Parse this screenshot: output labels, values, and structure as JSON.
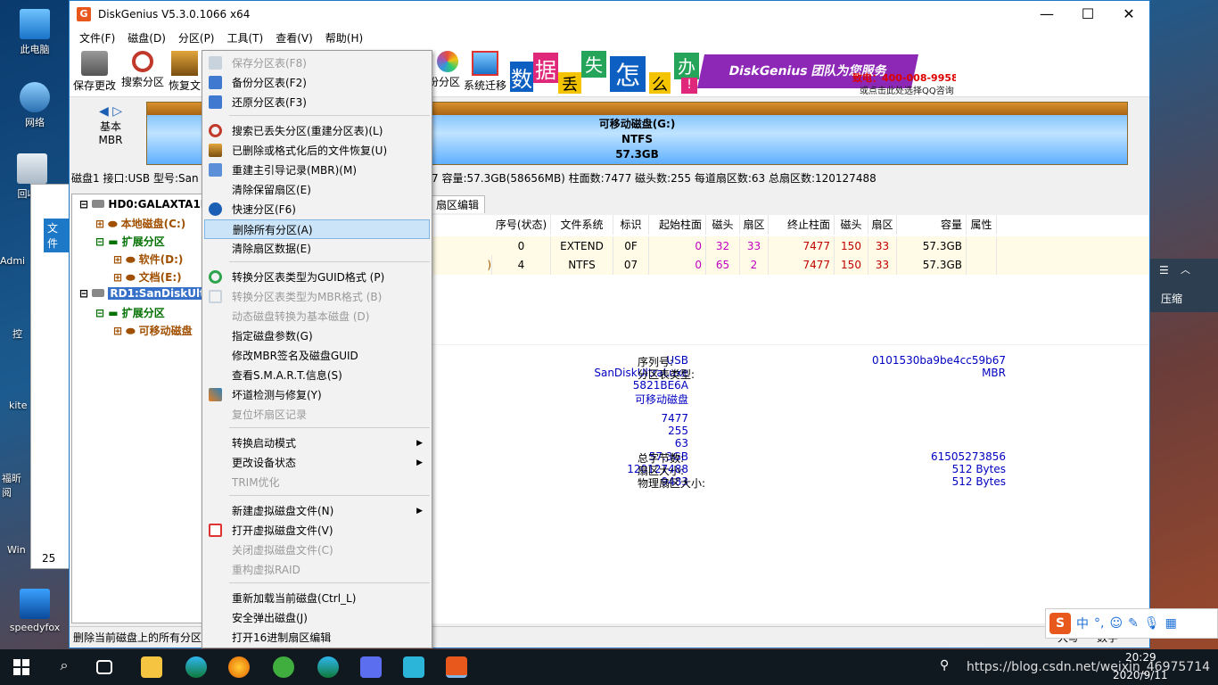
{
  "desktop": {
    "icons": [
      "此电脑",
      "网络",
      "回收站",
      "Admi",
      "控",
      "kite",
      "福昕阅",
      "Win",
      "speedyfox"
    ],
    "right_panel_label": "压缩",
    "explorer_tab": "文件",
    "explorer_count": "25"
  },
  "window": {
    "title": "DiskGenius V5.3.0.1066 x64",
    "app_icon_letter": "G",
    "min": "—",
    "max": "☐",
    "close": "✕"
  },
  "menubar": [
    "文件(F)",
    "磁盘(D)",
    "分区(P)",
    "工具(T)",
    "查看(V)",
    "帮助(H)"
  ],
  "toolbar": {
    "buttons": [
      "保存更改",
      "搜索分区",
      "恢复文",
      "份分区",
      "系统迁移"
    ]
  },
  "banner": {
    "chars": [
      "数",
      "据",
      "丢",
      "失",
      "怎",
      "么",
      "办",
      "!"
    ],
    "team": "DiskGenius 团队为您服务",
    "phone": "致电：400-008-9958",
    "qq": "或点击此处选择QQ咨询"
  },
  "disk_nav": {
    "line1": "基本",
    "line2": "MBR"
  },
  "disk_bar": {
    "name": "可移动磁盘(G:)",
    "fs": "NTFS",
    "size": "57.3GB"
  },
  "disk_info_prefix": "磁盘1 接口:USB  型号:San",
  "disk_info_suffix": "7  容量:57.3GB(58656MB)  柱面数:7477  磁头数:255  每道扇区数:63  总扇区数:120127488",
  "tree": [
    {
      "label": "HD0:GALAXTA1D",
      "level": 0
    },
    {
      "label": "本地磁盘(C:)",
      "level": 1
    },
    {
      "label": "扩展分区",
      "level": 1
    },
    {
      "label": "软件(D:)",
      "level": 2
    },
    {
      "label": "文档(E:)",
      "level": 2
    },
    {
      "label": "RD1:SanDiskUltr",
      "level": 0
    },
    {
      "label": "扩展分区",
      "level": 1
    },
    {
      "label": "可移动磁盘",
      "level": 2
    }
  ],
  "tab_visible": "扇区编辑",
  "table": {
    "headers": [
      "序号(状态)",
      "文件系统",
      "标识",
      "起始柱面",
      "磁头",
      "扇区",
      "终止柱面",
      "磁头",
      "扇区",
      "容量",
      "属性"
    ],
    "rows": [
      [
        "0",
        "EXTEND",
        "0F",
        "0",
        "32",
        "33",
        "7477",
        "150",
        "33",
        "57.3GB",
        ""
      ],
      [
        "4",
        "NTFS",
        "07",
        "0",
        "65",
        "2",
        "7477",
        "150",
        "33",
        "57.3GB",
        ""
      ]
    ],
    "row2_prefix": ")"
  },
  "details": {
    "left_values": [
      "USB",
      "SanDiskUltraLuxe",
      "5821BE6A",
      "可移动磁盘",
      "7477",
      "255",
      "63",
      "57.3GB",
      "120127488",
      "9483"
    ],
    "serial_label": "序列号:",
    "serial_value": "0101530ba9be4cc59b67",
    "ptype_label": "分区表类型:",
    "ptype_value": "MBR",
    "bytes_label": "总字节数:",
    "bytes_value": "61505273856",
    "sector_label": "扇区大小:",
    "sector_value": "512 Bytes",
    "phys_label": "物理扇区大小:",
    "phys_value": "512 Bytes"
  },
  "statusbar": {
    "text": "删除当前磁盘上的所有分区。",
    "right1": "大写",
    "right2": "数字"
  },
  "context_menu": [
    {
      "label": "保存分区表(F8)",
      "disabled": true
    },
    {
      "label": "备份分区表(F2)",
      "disabled": false
    },
    {
      "label": "还原分区表(F3)",
      "disabled": false
    },
    {
      "label": "搜索已丢失分区(重建分区表)(L)",
      "disabled": false
    },
    {
      "label": "已删除或格式化后的文件恢复(U)",
      "disabled": false
    },
    {
      "label": "重建主引导记录(MBR)(M)",
      "disabled": false
    },
    {
      "label": "清除保留扇区(E)",
      "disabled": false
    },
    {
      "label": "快速分区(F6)",
      "disabled": false
    },
    {
      "label": "删除所有分区(A)",
      "disabled": false,
      "highlight": true
    },
    {
      "label": "清除扇区数据(E)",
      "disabled": false
    },
    {
      "label": "转换分区表类型为GUID格式 (P)",
      "disabled": false
    },
    {
      "label": "转换分区表类型为MBR格式 (B)",
      "disabled": true
    },
    {
      "label": "动态磁盘转换为基本磁盘 (D)",
      "disabled": true
    },
    {
      "label": "指定磁盘参数(G)",
      "disabled": false
    },
    {
      "label": "修改MBR签名及磁盘GUID",
      "disabled": false
    },
    {
      "label": "查看S.M.A.R.T.信息(S)",
      "disabled": false
    },
    {
      "label": "坏道检测与修复(Y)",
      "disabled": false
    },
    {
      "label": "复位坏扇区记录",
      "disabled": true
    },
    {
      "label": "转换启动模式",
      "disabled": false,
      "submenu": true
    },
    {
      "label": "更改设备状态",
      "disabled": false,
      "submenu": true
    },
    {
      "label": "TRIM优化",
      "disabled": true
    },
    {
      "label": "新建虚拟磁盘文件(N)",
      "disabled": false,
      "submenu": true
    },
    {
      "label": "打开虚拟磁盘文件(V)",
      "disabled": false
    },
    {
      "label": "关闭虚拟磁盘文件(C)",
      "disabled": true
    },
    {
      "label": "重构虚拟RAID",
      "disabled": true
    },
    {
      "label": "重新加载当前磁盘(Ctrl_L)",
      "disabled": false
    },
    {
      "label": "安全弹出磁盘(J)",
      "disabled": false
    },
    {
      "label": "打开16进制扇区编辑",
      "disabled": false
    }
  ],
  "ime": {
    "mode": "中",
    "punct": "°,"
  },
  "tray": {
    "time": "20:29",
    "date": "2020/9/11",
    "watermark": "https://blog.csdn.net/weixin_46975714"
  },
  "colors": {
    "accent": "#1e78c8",
    "disk_blue": "#7cc4ff",
    "tree_brown": "#a05000",
    "tree_green": "#007000",
    "value_blue": "#0000c0",
    "value_red": "#c00000",
    "value_magenta": "#c000c0"
  }
}
